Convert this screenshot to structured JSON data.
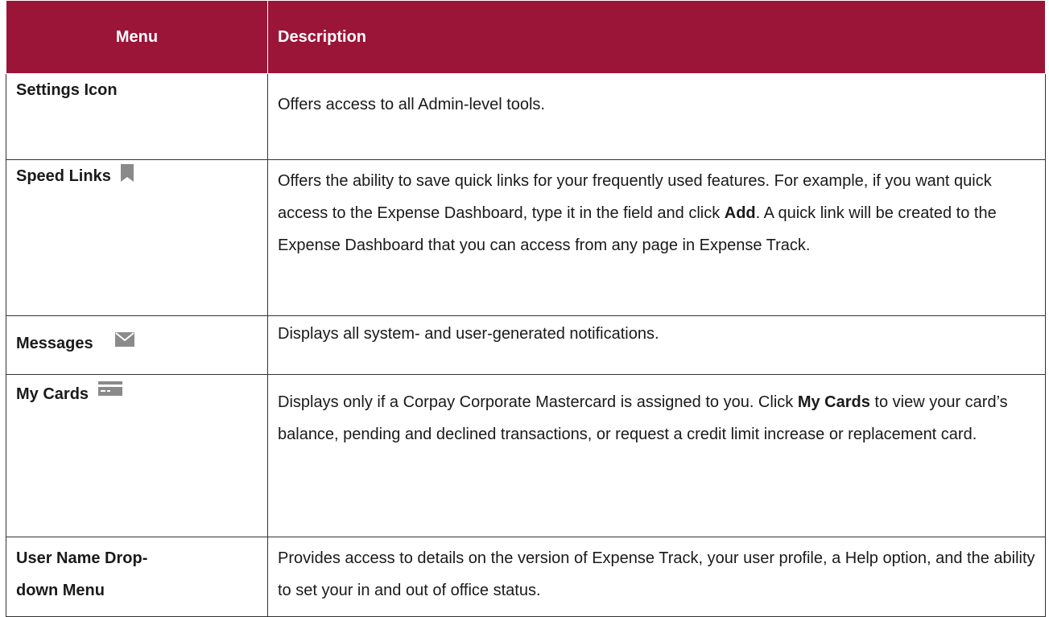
{
  "header": {
    "menu": "Menu",
    "description": "Description"
  },
  "rows": [
    {
      "menu": "Settings Icon",
      "description": "Offers access to all Admin-level tools."
    },
    {
      "menu": "Speed Links",
      "icon": "bookmark-icon",
      "description_parts": [
        "Offers the ability to save quick links for your frequently used features. For example, if you want quick access to the Expense Dashboard, type it in the field and click ",
        "Add",
        ". A quick link will be created to the Expense Dashboard that you can access from any page in Expense Track."
      ]
    },
    {
      "menu": "Messages",
      "icon": "envelope-icon",
      "description": "Displays all system- and user-generated notifications."
    },
    {
      "menu": "My Cards",
      "icon": "credit-card-icon",
      "description_parts": [
        "Displays only if a Corpay Corporate Mastercard is assigned to you. Click ",
        "My Cards",
        " to view your card’s balance, pending and declined transactions, or request a credit limit increase or replacement card."
      ]
    },
    {
      "menu": "User Name Drop-down Menu",
      "description": "Provides access to details on the version of Expense Track, your user profile, a Help option, and the ability to set your in and out of office status."
    }
  ],
  "colors": {
    "header_bg": "#9b1538",
    "header_text": "#ffffff",
    "icon_gray": "#8a8a8a"
  }
}
